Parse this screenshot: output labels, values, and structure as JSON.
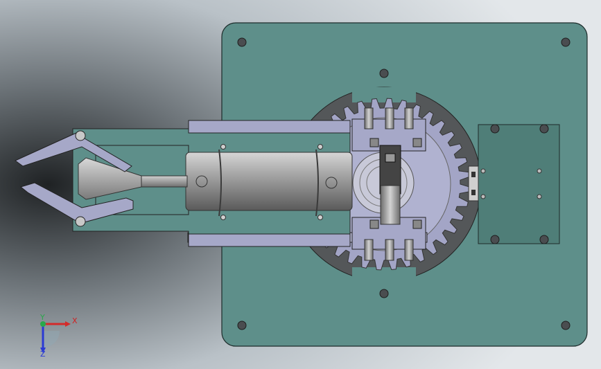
{
  "viewport": {
    "background_gradient": [
      "#2e3134",
      "#7f868c",
      "#c6cdd3",
      "#e6eaed"
    ]
  },
  "model": {
    "base_plate_color": "#5e8f8a",
    "ring_color": "#545759",
    "gear_color": "#a3a5c6",
    "arm_color": "#a6a8c8",
    "cylinder_color": "#9a9a9a",
    "motor_plate_color": "#4f7e78"
  },
  "triad": {
    "x_label": "X",
    "y_label": "Y",
    "z_label": "Z",
    "x_color": "#d42a2a",
    "y_color": "#2aa84a",
    "z_color": "#2a3ad4"
  }
}
